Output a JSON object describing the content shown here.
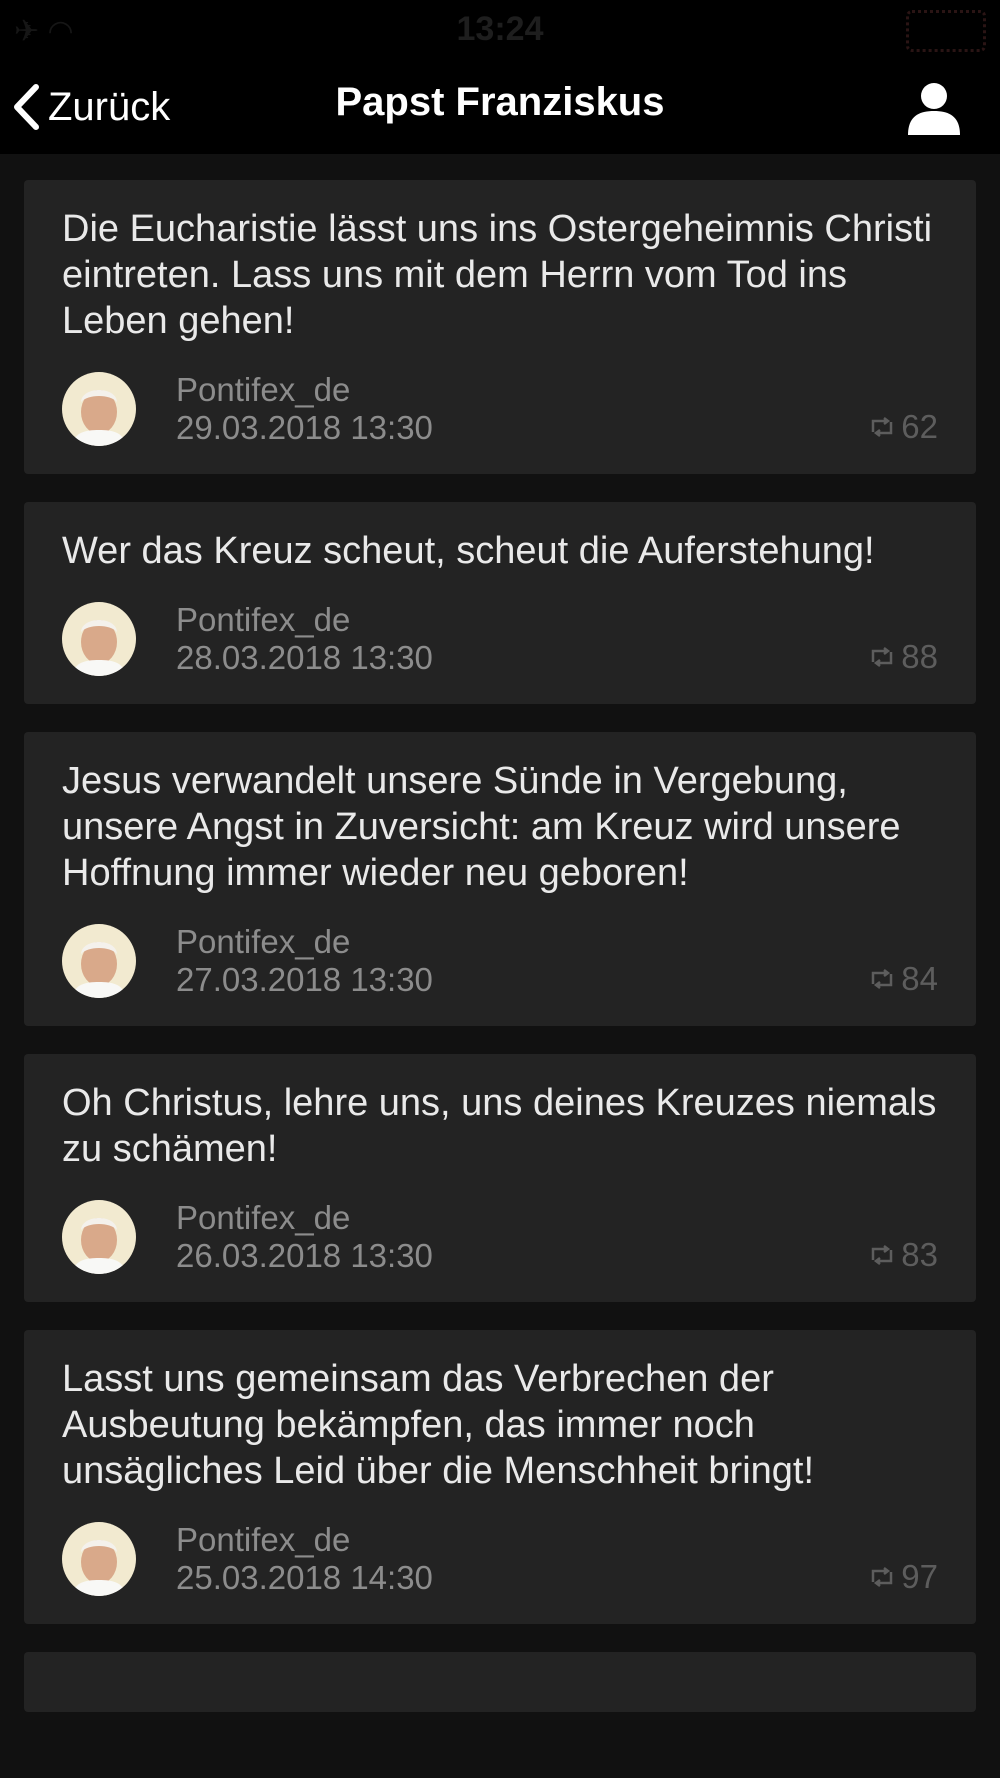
{
  "status_bar": {
    "time": "13:24"
  },
  "nav": {
    "back_label": "Zurück",
    "title": "Papst Franziskus"
  },
  "feed": {
    "items": [
      {
        "text": "Die Eucharistie lässt uns ins Ostergeheimnis Christi eintreten. Lass uns mit dem Herrn vom Tod ins Leben gehen!",
        "handle": "Pontifex_de",
        "timestamp": "29.03.2018 13:30",
        "retweets": "62"
      },
      {
        "text": "Wer das Kreuz scheut, scheut die Auferstehung!",
        "handle": "Pontifex_de",
        "timestamp": "28.03.2018 13:30",
        "retweets": "88"
      },
      {
        "text": "Jesus verwandelt unsere Sünde in Vergebung, unsere Angst in Zuversicht: am Kreuz wird unsere Hoffnung immer wieder neu geboren!",
        "handle": "Pontifex_de",
        "timestamp": "27.03.2018 13:30",
        "retweets": "84"
      },
      {
        "text": "Oh Christus, lehre uns, uns deines Kreuzes niemals zu schämen!",
        "handle": "Pontifex_de",
        "timestamp": "26.03.2018 13:30",
        "retweets": "83"
      },
      {
        "text": "Lasst uns gemeinsam das Verbrechen der Ausbeutung bekämpfen, das immer noch unsägliches Leid über die Menschheit bringt!",
        "handle": "Pontifex_de",
        "timestamp": "25.03.2018 14:30",
        "retweets": "97"
      }
    ]
  },
  "icons": {
    "back": "chevron-left-icon",
    "profile": "user-icon",
    "retweet": "retweet-icon",
    "avatar": "avatar"
  },
  "colors": {
    "background": "#111111",
    "card": "#232323",
    "nav": "#000000",
    "text": "#e9e9e9",
    "meta": "#8c8c8c"
  }
}
